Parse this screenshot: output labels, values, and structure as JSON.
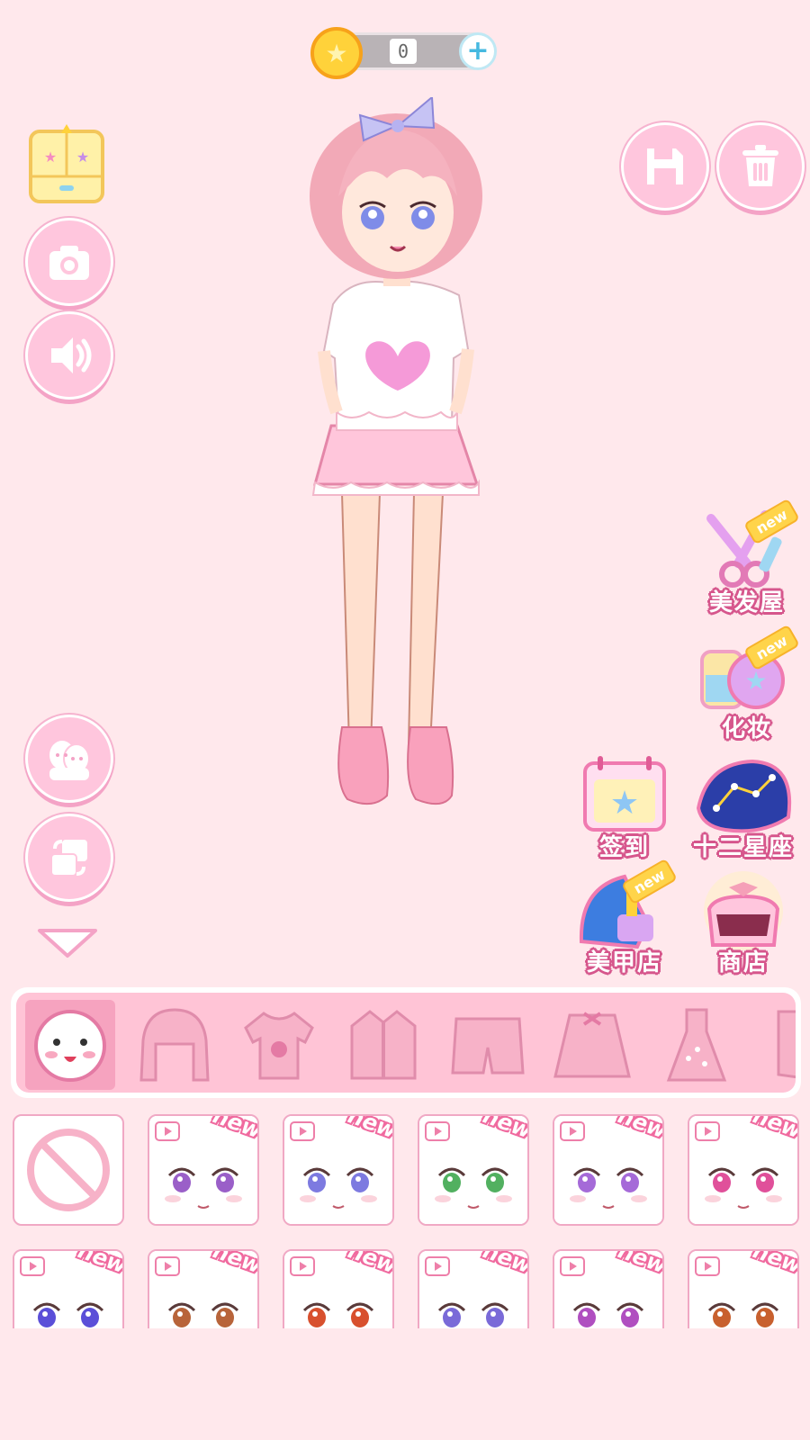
{
  "currency": {
    "coins": "0",
    "add_label": "+"
  },
  "colors": {
    "background": "#ffe8ec",
    "accent_pink": "#ffc6dd",
    "label_outline": "#d6568c",
    "coin": "#ffd23a",
    "new_tag": "#ffd44a"
  },
  "left_buttons": {
    "wardrobe": "wardrobe-icon",
    "camera": "camera-icon",
    "sound": "speaker-icon",
    "friends": "faces-icon",
    "swap": "swap-icon",
    "collapse": "chevron-down-icon"
  },
  "top_right_buttons": {
    "save": "save-icon",
    "delete": "trash-icon"
  },
  "features": [
    {
      "label": "美发屋",
      "icon": "scissors-icon",
      "new": "new"
    },
    {
      "label": "化妆",
      "icon": "makeup-icon",
      "new": "new"
    },
    {
      "label": "签到",
      "icon": "calendar-icon",
      "new": ""
    },
    {
      "label": "十二星座",
      "icon": "constellation-icon",
      "new": ""
    },
    {
      "label": "美甲店",
      "icon": "nail-polish-icon",
      "new": "new"
    },
    {
      "label": "商店",
      "icon": "shop-bag-icon",
      "new": ""
    }
  ],
  "categories": [
    "face",
    "hair",
    "tshirt",
    "jacket",
    "shorts",
    "skirt",
    "dress",
    "socks"
  ],
  "selected_category": "face",
  "grid": {
    "new_label": "new",
    "items": [
      {
        "type": "none"
      },
      {
        "type": "face",
        "eye": "#9a5fc8"
      },
      {
        "type": "face",
        "eye": "#7d7ae0"
      },
      {
        "type": "face",
        "eye": "#52b060"
      },
      {
        "type": "face",
        "eye": "#a56ad8"
      },
      {
        "type": "face",
        "eye": "#e0509a"
      },
      {
        "type": "face",
        "eye": "#5b4fd8"
      },
      {
        "type": "face",
        "eye": "#b8643a"
      },
      {
        "type": "face",
        "eye": "#d8502e"
      },
      {
        "type": "face",
        "eye": "#7a6ad8"
      },
      {
        "type": "face",
        "eye": "#b04fc0"
      },
      {
        "type": "face",
        "eye": "#c8602e"
      }
    ]
  }
}
